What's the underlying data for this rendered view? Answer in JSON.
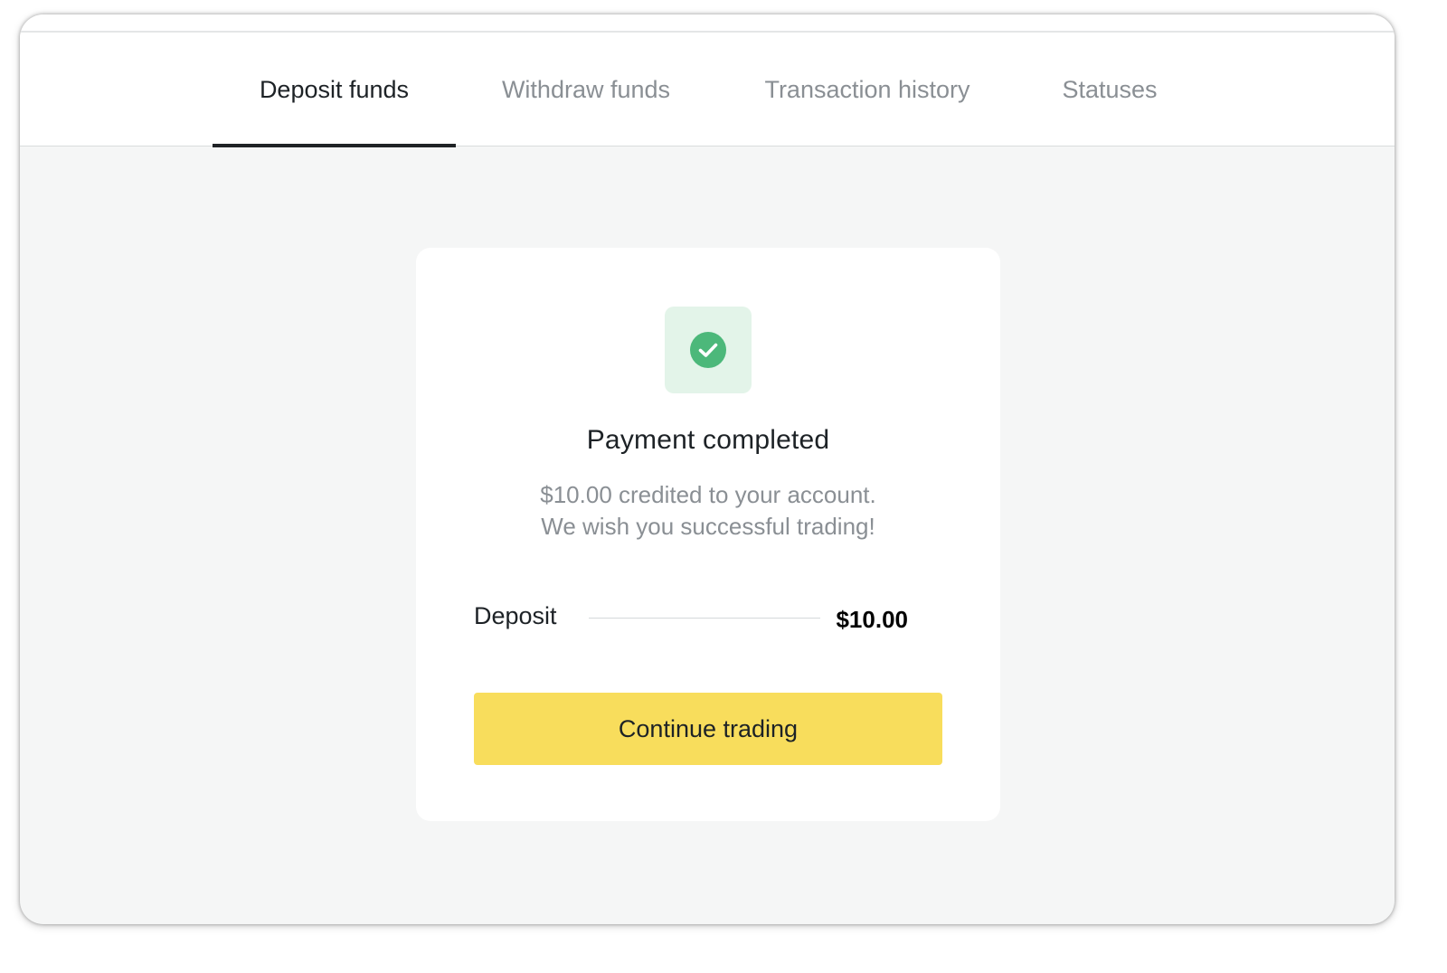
{
  "tabs": {
    "deposit": "Deposit funds",
    "withdraw": "Withdraw funds",
    "history": "Transaction history",
    "statuses": "Statuses",
    "active": "deposit"
  },
  "card": {
    "icon": "check-circle-icon",
    "title": "Payment completed",
    "message_line1": "$10.00 credited to your account.",
    "message_line2": "We wish you successful trading!",
    "deposit_label": "Deposit",
    "deposit_value": "$10.00",
    "button_label": "Continue trading"
  },
  "colors": {
    "accent_button": "#f8dd5c",
    "success_green": "#4cb87a",
    "success_bg": "#e3f4e9",
    "page_bg": "#f5f6f6"
  }
}
